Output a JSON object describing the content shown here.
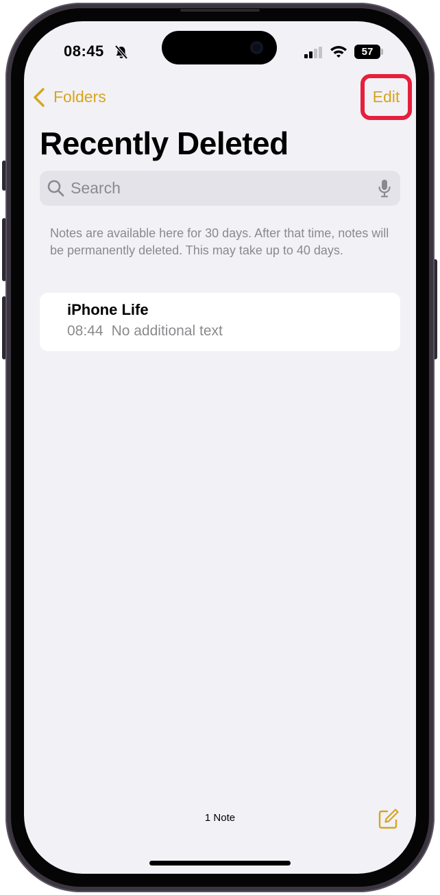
{
  "status_bar": {
    "time": "08:45",
    "battery_level": "57",
    "silent_mode": true,
    "icons": [
      "bell-slash-icon",
      "cellular-signal-icon",
      "wifi-icon",
      "battery-icon"
    ]
  },
  "nav": {
    "back_label": "Folders",
    "edit_label": "Edit",
    "title": "Recently Deleted"
  },
  "search": {
    "placeholder": "Search",
    "value": ""
  },
  "info_text": "Notes are available here for 30 days. After that time, notes will be permanently deleted. This may take up to 40 days.",
  "notes": [
    {
      "title": "iPhone Life",
      "time": "08:44",
      "preview": "No additional text"
    }
  ],
  "toolbar": {
    "note_count": "1 Note"
  },
  "colors": {
    "accent": "#d6a51f",
    "highlight": "#e5203d",
    "background": "#f2f1f6",
    "secondary_text": "#8a8a8e"
  }
}
